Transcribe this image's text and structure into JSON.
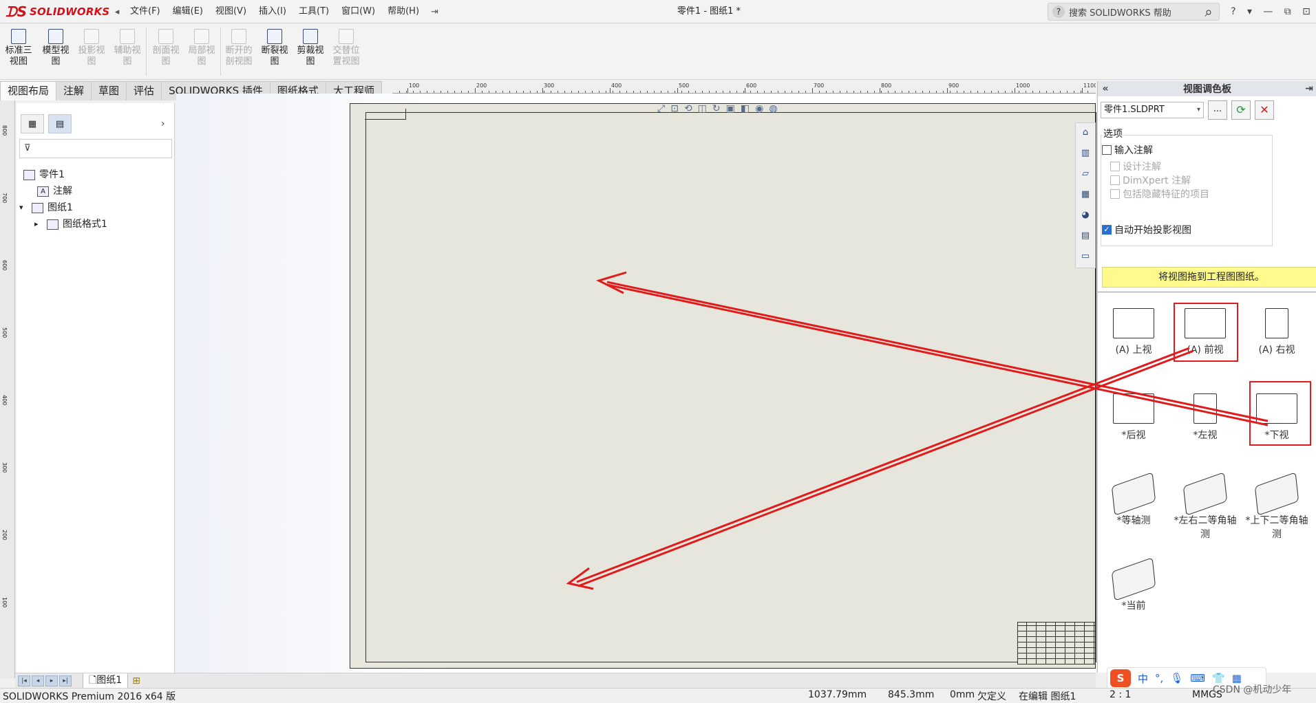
{
  "app": {
    "brand": "SOLIDWORKS",
    "document_title": "零件1 - 图纸1 *",
    "menu": [
      "文件(F)",
      "编辑(E)",
      "视图(V)",
      "插入(I)",
      "工具(T)",
      "窗口(W)",
      "帮助(H)"
    ],
    "help_search_placeholder": "搜索 SOLIDWORKS 帮助",
    "window_controls": [
      "?",
      "▾",
      "—",
      "⧉",
      "⊡"
    ]
  },
  "commands": [
    {
      "label": "标准三视图",
      "enabled": true
    },
    {
      "label": "模型视图",
      "enabled": true
    },
    {
      "label": "投影视图",
      "enabled": false
    },
    {
      "label": "辅助视图",
      "enabled": false
    },
    {
      "label": "剖面视图",
      "enabled": false
    },
    {
      "label": "局部视图",
      "enabled": false
    },
    {
      "label": "断开的剖视图",
      "enabled": false
    },
    {
      "label": "断裂视图",
      "enabled": true
    },
    {
      "label": "剪裁视图",
      "enabled": true
    },
    {
      "label": "交替位置视图",
      "enabled": false
    }
  ],
  "tabs": [
    "视图布局",
    "注解",
    "草图",
    "评估",
    "SOLIDWORKS 插件",
    "图纸格式",
    "大工程师"
  ],
  "feature_tree": [
    {
      "label": "零件1",
      "icon": "drawing-icon",
      "expander": ""
    },
    {
      "label": "注解",
      "icon": "annotation-icon",
      "expander": ""
    },
    {
      "label": "图纸1",
      "icon": "sheet-icon",
      "expander": "▾"
    },
    {
      "label": "图纸格式1",
      "icon": "sheet-format-icon",
      "expander": "▸"
    }
  ],
  "ruler_top": [
    "100",
    "200",
    "300",
    "400",
    "500",
    "600",
    "700",
    "800",
    "900",
    "1000",
    "1100"
  ],
  "ruler_left": [
    "800",
    "700",
    "600",
    "500",
    "400",
    "300",
    "200",
    "100"
  ],
  "palette": {
    "title": "视图调色板",
    "part": "零件1.SLDPRT",
    "browse": "...",
    "options_title": "选项",
    "options": [
      {
        "label": "输入注解",
        "checked": false,
        "enabled": true
      },
      {
        "label": "设计注解",
        "checked": false,
        "enabled": false
      },
      {
        "label": "DimXpert 注解",
        "checked": false,
        "enabled": false
      },
      {
        "label": "包括隐藏特征的项目",
        "checked": false,
        "enabled": false
      },
      {
        "label": "自动开始投影视图",
        "checked": true,
        "enabled": true
      }
    ],
    "hint": "将视图拖到工程图图纸。",
    "views": [
      {
        "label": "(A) 上视",
        "iso": false,
        "highlighted": false
      },
      {
        "label": "(A) 前视",
        "iso": false,
        "highlighted": true
      },
      {
        "label": "(A) 右视",
        "iso": false,
        "highlighted": false
      },
      {
        "label": "*后视",
        "iso": false,
        "highlighted": false
      },
      {
        "label": "*左视",
        "iso": false,
        "highlighted": false
      },
      {
        "label": "*下视",
        "iso": false,
        "highlighted": true
      },
      {
        "label": "*等轴测",
        "iso": true,
        "highlighted": false
      },
      {
        "label": "*左右二等角轴测",
        "iso": true,
        "highlighted": false
      },
      {
        "label": "*上下二等角轴测",
        "iso": true,
        "highlighted": false
      },
      {
        "label": "*当前",
        "iso": true,
        "highlighted": false
      }
    ]
  },
  "sheet_tab": "图纸1",
  "status": {
    "product": "SOLIDWORKS Premium 2016 x64 版",
    "x": "1037.79mm",
    "y": "845.3mm",
    "z": "0mm",
    "state": "欠定义",
    "editing": "在编辑 图纸1",
    "scale": "2 : 1",
    "units": "MMGS"
  },
  "ime": {
    "lang": "中",
    "punct": "°,"
  },
  "watermark": "CSDN @机动少年",
  "colors": {
    "annotation_red": "#e11b1b",
    "brand_red": "#d6101a",
    "hint_yellow": "#fefb8c"
  }
}
